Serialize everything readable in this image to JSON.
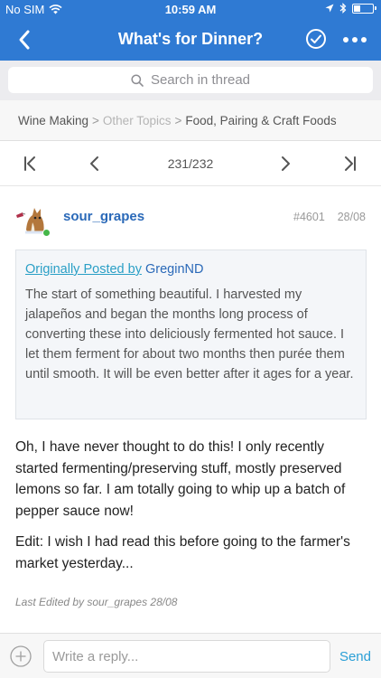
{
  "status_bar": {
    "carrier": "No SIM",
    "time": "10:59 AM",
    "battery_level": 0.3
  },
  "nav": {
    "title": "What's for Dinner?",
    "back_icon": "chevron-left-icon",
    "check_icon": "check-circle-icon",
    "more_icon": "more-horizontal-icon"
  },
  "search": {
    "placeholder": "Search in thread"
  },
  "breadcrumb": {
    "items": [
      "Wine Making",
      "Other Topics",
      "Food, Pairing & Craft Foods"
    ],
    "separator": ">"
  },
  "pager": {
    "position": "231/232"
  },
  "post": {
    "username": "sour_grapes",
    "post_number": "#4601",
    "date": "28/08",
    "quote": {
      "prefix": "Originally Posted by",
      "author": "GreginND",
      "text": "The start of something beautiful. I harvested my jalapeños and began the months long process of converting these into deliciously fermented hot sauce. I let them ferment for about two months then purée them until smooth. It will be even better after it ages for a year."
    },
    "paragraphs": [
      "Oh, I have never thought to do this!  I only recently started fermenting/preserving stuff, mostly preserved lemons so far.  I am totally going to whip up a batch of pepper sauce now!",
      "Edit: I wish I had read this before going to the farmer's market yesterday..."
    ],
    "edited_note": "Last Edited by sour_grapes 28/08"
  },
  "reply": {
    "placeholder": "Write a reply...",
    "send_label": "Send"
  },
  "colors": {
    "nav_blue": "#2f7ad3",
    "link_blue": "#2a69b8",
    "quote_link": "#2a9fc6",
    "online_green": "#45b649"
  }
}
